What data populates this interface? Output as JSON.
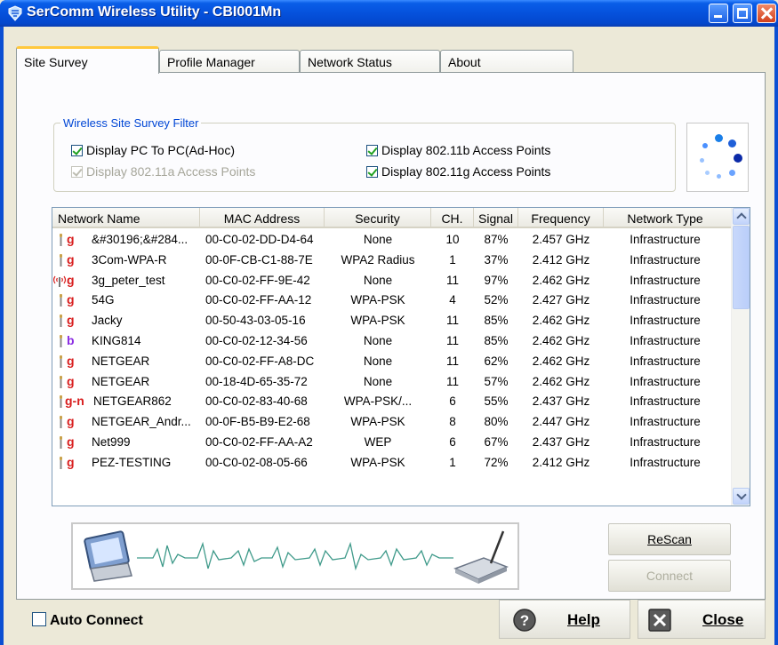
{
  "window": {
    "title": "SerComm Wireless Utility - CBI001Mn"
  },
  "tabs": [
    {
      "label": "Site Survey",
      "active": true
    },
    {
      "label": "Profile Manager",
      "active": false
    },
    {
      "label": "Network Status",
      "active": false
    },
    {
      "label": "About",
      "active": false
    }
  ],
  "filter": {
    "title": "Wireless Site Survey Filter",
    "options": [
      {
        "label": "Display PC To PC(Ad-Hoc)",
        "checked": true,
        "enabled": true
      },
      {
        "label": "Display 802.11a Access Points",
        "checked": true,
        "enabled": false
      },
      {
        "label": "Display 802.11b Access Points",
        "checked": true,
        "enabled": true
      },
      {
        "label": "Display 802.11g Access Points",
        "checked": true,
        "enabled": true
      }
    ]
  },
  "table": {
    "columns": [
      "Network Name",
      "MAC Address",
      "Security",
      "CH.",
      "Signal",
      "Frequency",
      "Network Type"
    ],
    "rows": [
      {
        "band": "g",
        "name": "&#30196;&#284...",
        "mac": "00-C0-02-DD-D4-64",
        "security": "None",
        "ch": "10",
        "signal": "87%",
        "freq": "2.457 GHz",
        "type": "Infrastructure",
        "icon": "antenna-icon"
      },
      {
        "band": "g",
        "name": "3Com-WPA-R",
        "mac": "00-0F-CB-C1-88-7E",
        "security": "WPA2 Radius",
        "ch": "1",
        "signal": "37%",
        "freq": "2.412 GHz",
        "type": "Infrastructure",
        "icon": "antenna-icon"
      },
      {
        "band": "g",
        "name": "3g_peter_test",
        "mac": "00-C0-02-FF-9E-42",
        "security": "None",
        "ch": "11",
        "signal": "97%",
        "freq": "2.462 GHz",
        "type": "Infrastructure",
        "icon": "broadcast-antenna-icon"
      },
      {
        "band": "g",
        "name": "54G",
        "mac": "00-C0-02-FF-AA-12",
        "security": "WPA-PSK",
        "ch": "4",
        "signal": "52%",
        "freq": "2.427 GHz",
        "type": "Infrastructure",
        "icon": "antenna-icon"
      },
      {
        "band": "g",
        "name": "Jacky",
        "mac": "00-50-43-03-05-16",
        "security": "WPA-PSK",
        "ch": "11",
        "signal": "85%",
        "freq": "2.462 GHz",
        "type": "Infrastructure",
        "icon": "antenna-icon"
      },
      {
        "band": "b",
        "name": "KING814",
        "mac": "00-C0-02-12-34-56",
        "security": "None",
        "ch": "11",
        "signal": "85%",
        "freq": "2.462 GHz",
        "type": "Infrastructure",
        "icon": "antenna-icon"
      },
      {
        "band": "g",
        "name": "NETGEAR",
        "mac": "00-C0-02-FF-A8-DC",
        "security": "None",
        "ch": "11",
        "signal": "62%",
        "freq": "2.462 GHz",
        "type": "Infrastructure",
        "icon": "antenna-icon"
      },
      {
        "band": "g",
        "name": "NETGEAR",
        "mac": "00-18-4D-65-35-72",
        "security": "None",
        "ch": "11",
        "signal": "57%",
        "freq": "2.462 GHz",
        "type": "Infrastructure",
        "icon": "antenna-icon"
      },
      {
        "band": "g-n",
        "name": "NETGEAR862",
        "mac": "00-C0-02-83-40-68",
        "security": "WPA-PSK/...",
        "ch": "6",
        "signal": "55%",
        "freq": "2.437 GHz",
        "type": "Infrastructure",
        "icon": "antenna-icon"
      },
      {
        "band": "g",
        "name": "NETGEAR_Andr...",
        "mac": "00-0F-B5-B9-E2-68",
        "security": "WPA-PSK",
        "ch": "8",
        "signal": "80%",
        "freq": "2.447 GHz",
        "type": "Infrastructure",
        "icon": "antenna-icon"
      },
      {
        "band": "g",
        "name": "Net999",
        "mac": "00-C0-02-FF-AA-A2",
        "security": "WEP",
        "ch": "6",
        "signal": "67%",
        "freq": "2.437 GHz",
        "type": "Infrastructure",
        "icon": "antenna-icon"
      },
      {
        "band": "g",
        "name": "PEZ-TESTING",
        "mac": "00-C0-02-08-05-66",
        "security": "WPA-PSK",
        "ch": "1",
        "signal": "72%",
        "freq": "2.412 GHz",
        "type": "Infrastructure",
        "icon": "antenna-icon"
      }
    ]
  },
  "actions": {
    "rescan_label": "ReScan",
    "connect_label": "Connect",
    "connect_enabled": false
  },
  "footer": {
    "auto_connect_label": "Auto Connect",
    "auto_connect_checked": false,
    "help_label": "Help",
    "close_label": "Close"
  },
  "colors": {
    "titlebar": "#0551dc",
    "band_g": "#d81e1e",
    "band_b": "#8a2be2",
    "group_title": "#0046d5"
  }
}
